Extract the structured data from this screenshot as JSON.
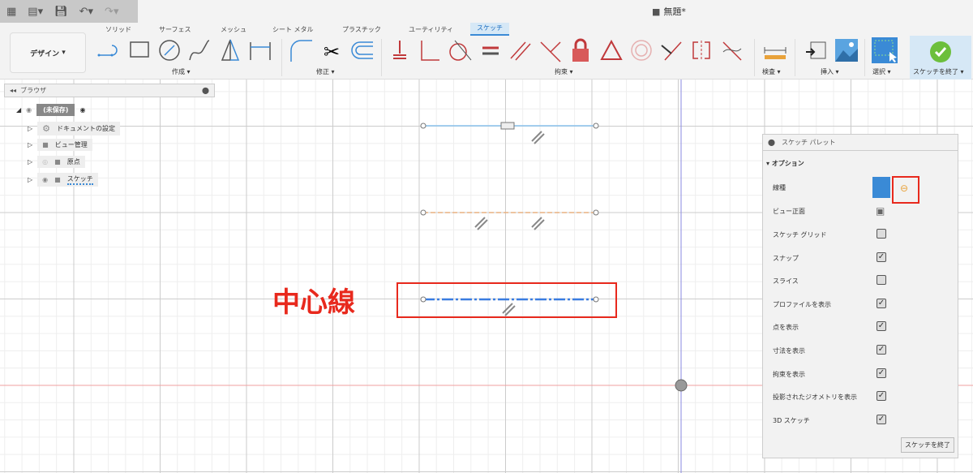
{
  "title": "無題*",
  "workspace": "デザイン",
  "tabs": [
    "ソリッド",
    "サーフェス",
    "メッシュ",
    "シート メタル",
    "プラスチック",
    "ユーティリティ",
    "スケッチ"
  ],
  "groups": {
    "create": "作成 ▾",
    "modify": "修正 ▾",
    "constraints": "拘束 ▾",
    "inspect": "検査 ▾",
    "insert": "挿入 ▾",
    "select": "選択 ▾",
    "finish": "スケッチを終了 ▾"
  },
  "browser": {
    "title": "ブラウザ",
    "root": "(未保存)",
    "items": [
      "ドキュメントの設定",
      "ビュー管理",
      "原点",
      "スケッチ"
    ]
  },
  "palette": {
    "title": "スケッチ パレット",
    "section": "オプション",
    "rows": [
      {
        "label": "線種"
      },
      {
        "label": "ビュー正面"
      },
      {
        "label": "スケッチ グリッド",
        "checked": false
      },
      {
        "label": "スナップ",
        "checked": true
      },
      {
        "label": "スライス",
        "checked": false
      },
      {
        "label": "プロファイルを表示",
        "checked": true
      },
      {
        "label": "点を表示",
        "checked": true
      },
      {
        "label": "寸法を表示",
        "checked": true
      },
      {
        "label": "拘束を表示",
        "checked": true
      },
      {
        "label": "投影されたジオメトリを表示",
        "checked": true
      },
      {
        "label": "3D スケッチ",
        "checked": true
      }
    ],
    "finish_button": "スケッチを終了"
  },
  "annotation": "中心線",
  "colors": {
    "accent": "#3a8ad6",
    "annotation": "#e8291d",
    "constraint": "#c0393b"
  }
}
